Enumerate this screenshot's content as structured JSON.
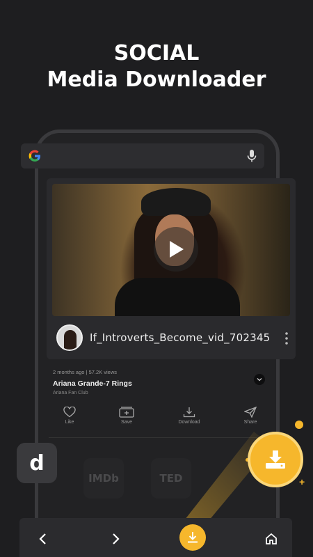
{
  "headline": {
    "line1": "SOCIAL",
    "line2": "Media Downloader"
  },
  "search": {
    "engine_icon": "google-g-icon",
    "mic_icon": "microphone-icon"
  },
  "video": {
    "title": "If_Introverts_Become_vid_702345",
    "meta": "2 months ago | 57.2K views",
    "song": "Ariana Grande-7 Rings",
    "channel": "Ariana Fan Club"
  },
  "actions": [
    {
      "label": "Like",
      "icon": "heart-icon"
    },
    {
      "label": "Save",
      "icon": "save-icon"
    },
    {
      "label": "Download",
      "icon": "download-icon"
    },
    {
      "label": "Share",
      "icon": "send-icon"
    }
  ],
  "sites": [
    "IMDb",
    "TED"
  ],
  "app_logo": "d",
  "colors": {
    "accent": "#f6b72c",
    "background": "#1e1e20"
  }
}
